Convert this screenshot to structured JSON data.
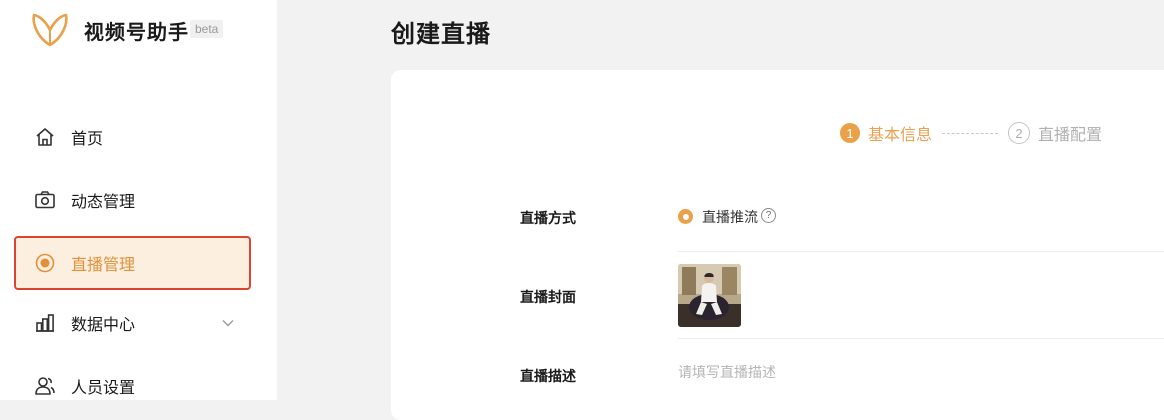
{
  "app": {
    "name": "视频号助手",
    "badge": "beta"
  },
  "sidebar": {
    "items": [
      {
        "label": "首页",
        "icon": "home-icon"
      },
      {
        "label": "动态管理",
        "icon": "camera-icon"
      },
      {
        "label": "直播管理",
        "icon": "live-icon",
        "active": true
      },
      {
        "label": "数据中心",
        "icon": "bar-chart-icon",
        "expandable": true
      },
      {
        "label": "人员设置",
        "icon": "users-icon"
      }
    ]
  },
  "page": {
    "title": "创建直播"
  },
  "steps": [
    {
      "number": "1",
      "label": "基本信息",
      "active": true
    },
    {
      "number": "2",
      "label": "直播配置",
      "active": false
    }
  ],
  "form": {
    "method": {
      "label": "直播方式",
      "option": "直播推流",
      "help": "?"
    },
    "cover": {
      "label": "直播封面"
    },
    "description": {
      "label": "直播描述",
      "placeholder": "请填写直播描述",
      "value": ""
    }
  },
  "colors": {
    "accent": "#eba04a",
    "active_border": "#d9452f",
    "active_bg": "#fcefdf"
  }
}
